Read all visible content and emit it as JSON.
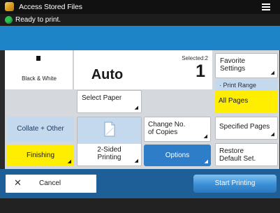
{
  "header": {
    "title": "Access Stored Files",
    "app_icon": "printer-app-icon",
    "menu_icon": "hamburger-menu-icon"
  },
  "status": {
    "text": "Ready to print.",
    "icon": "ready-status-icon",
    "color": "#29c24e"
  },
  "settings": {
    "color_mode": {
      "label": "Black & White",
      "icon": "black-white-icon"
    },
    "paper": {
      "value": "Auto"
    },
    "copies": {
      "selected_label": "Selected:2",
      "count": "1"
    },
    "select_paper_label": "Select Paper"
  },
  "buttons": {
    "favorite_line1": "Favorite",
    "favorite_line2": "Settings",
    "print_range_label": "Print Range",
    "all_pages": "All Pages",
    "specified_pages": "Specified Pages",
    "restore_line1": "Restore",
    "restore_line2": "Default Set.",
    "collate_other": "Collate + Other",
    "finishing": "Finishing",
    "two_sided_line1": "2-Sided",
    "two_sided_line2": "Printing",
    "change_copies_line1": "Change No.",
    "change_copies_line2": "of Copies",
    "options": "Options",
    "cancel": "Cancel",
    "start_printing": "Start Printing"
  },
  "colors": {
    "accent_blue": "#1e84c8",
    "selected_yellow": "#ffee00",
    "bottom_bar": "#1f5f97"
  }
}
